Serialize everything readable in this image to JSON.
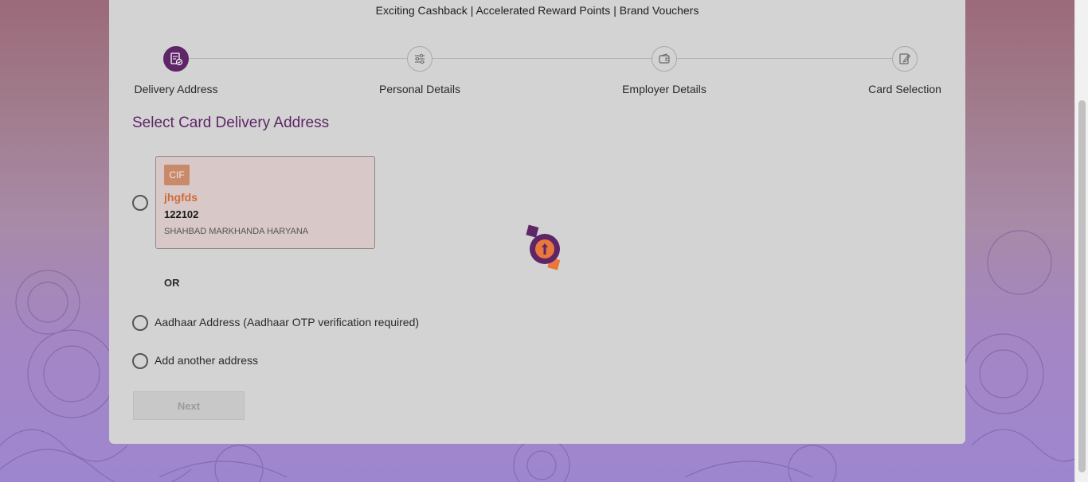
{
  "tagline": "Exciting Cashback | Accelerated Reward Points | Brand Vouchers",
  "steps": [
    {
      "label": "Delivery Address",
      "icon": "document-check-icon",
      "active": true
    },
    {
      "label": "Personal Details",
      "icon": "sliders-icon",
      "active": false
    },
    {
      "label": "Employer Details",
      "icon": "wallet-icon",
      "active": false
    },
    {
      "label": "Card Selection",
      "icon": "edit-note-icon",
      "active": false
    }
  ],
  "section_title": "Select Card Delivery Address",
  "address_card": {
    "badge": "CIF",
    "name": "jhgfds",
    "pincode": "122102",
    "address": "SHAHBAD MARKHANDA HARYANA"
  },
  "or_text": "OR",
  "options": {
    "aadhaar": "Aadhaar Address (Aadhaar OTP verification required)",
    "another": "Add another address"
  },
  "next_label": "Next",
  "colors": {
    "brand": "#5e2567",
    "accent": "#cf6b3a",
    "overlay": "#d3d3d3"
  }
}
